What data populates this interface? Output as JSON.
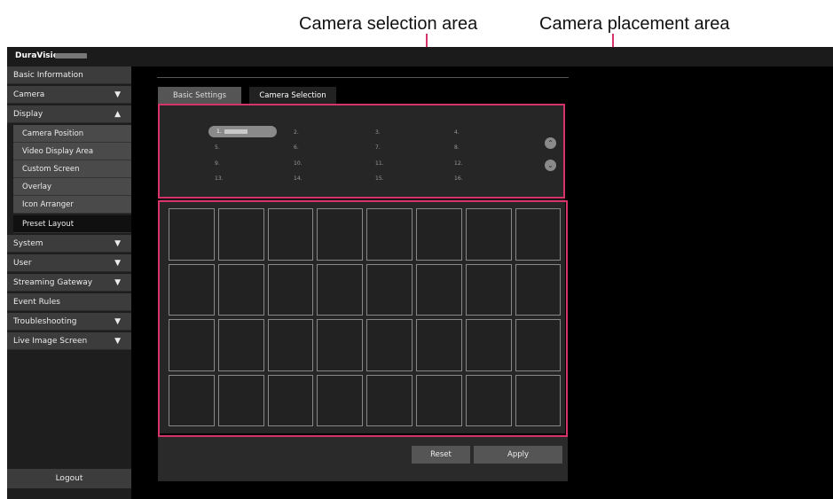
{
  "annotations": {
    "selection_label": "Camera selection area",
    "placement_label": "Camera placement area",
    "highlight_color": "#d6336c"
  },
  "header": {
    "brand": "DuraVision"
  },
  "sidebar": {
    "items": [
      {
        "label": "Basic Information",
        "arrow": ""
      },
      {
        "label": "Camera",
        "arrow": "▼"
      },
      {
        "label": "Display",
        "arrow": "▲"
      }
    ],
    "display_sub_items": [
      {
        "label": "Camera Position"
      },
      {
        "label": "Video Display Area"
      },
      {
        "label": "Custom Screen"
      },
      {
        "label": "Overlay"
      },
      {
        "label": "Icon Arranger"
      },
      {
        "label": "Preset Layout"
      }
    ],
    "items_after": [
      {
        "label": "System",
        "arrow": "▼"
      },
      {
        "label": "User",
        "arrow": "▼"
      },
      {
        "label": "Streaming Gateway",
        "arrow": "▼"
      },
      {
        "label": "Event Rules",
        "arrow": ""
      },
      {
        "label": "Troubleshooting",
        "arrow": "▼"
      },
      {
        "label": "Live Image Screen",
        "arrow": "▼"
      }
    ],
    "logout_label": "Logout"
  },
  "tabs": [
    {
      "label": "Basic Settings"
    },
    {
      "label": "Camera Selection"
    }
  ],
  "camera_slots": [
    "1.",
    "2.",
    "3.",
    "4.",
    "5.",
    "6.",
    "7.",
    "8.",
    "9.",
    "10.",
    "11.",
    "12.",
    "13.",
    "14.",
    "15.",
    "16."
  ],
  "scroll_up_icon": "chevron-up-icon",
  "scroll_down_icon": "chevron-down-icon",
  "placement_grid": {
    "rows": 4,
    "cols": 8
  },
  "buttons": {
    "reset": "Reset",
    "apply": "Apply"
  }
}
